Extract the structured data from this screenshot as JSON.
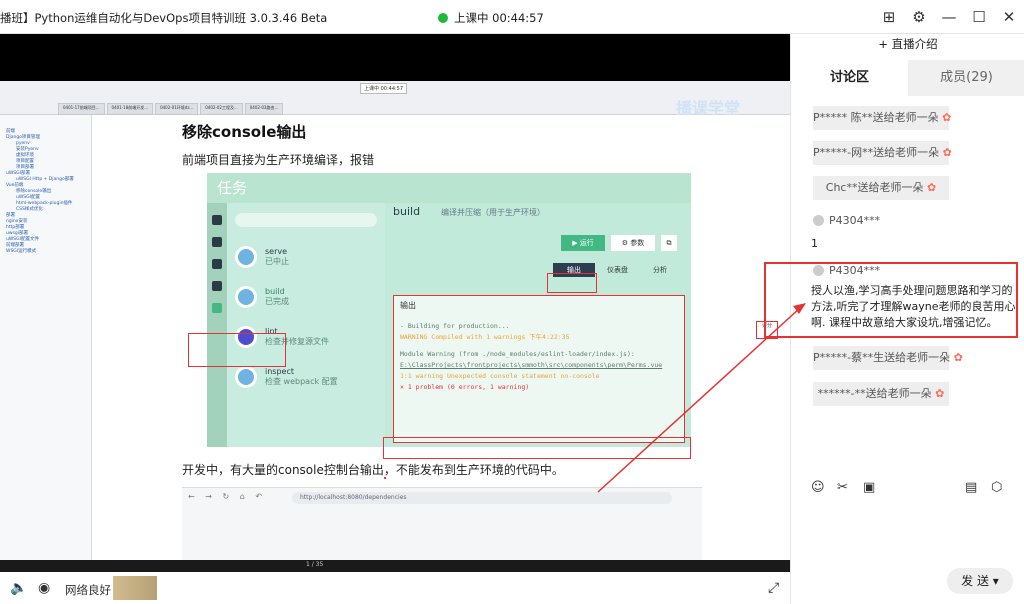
{
  "titlebar": {
    "app_title": "播班】Python运维自动化与DevOps项目特训班 3.0.3.46 Beta",
    "status": "上课中 00:44:57",
    "buttons": [
      "⊞",
      "⚙",
      "—",
      "☐",
      "✕"
    ]
  },
  "slide": {
    "mini_live": "上课中 00:44:57",
    "tabs": [
      "0401-17前端项目...",
      "0401-18前端开发...",
      "0402-01环境dz...",
      "0402-02工程及...",
      "0402-03路由..."
    ],
    "watermark": "播课学堂",
    "sidebar_lines": [
      "前端",
      "Django项目管理",
      "pyenv",
      "安装Pyenv",
      "虚拟环境",
      "项目配置",
      "项目部署",
      "uWSGI部署",
      "uWSGI Http + Django部署",
      "Vue前端",
      "移除console输出",
      "uWSGI配置",
      "html-webpack-plugin插件",
      "CSS样式优化",
      "部署",
      "nginx安装",
      "http部署",
      "uwsgi部署",
      "uWSGI配置文件",
      "前端部署",
      "WSGI运行模式"
    ],
    "doc_title": "移除console输出",
    "doc_p1": "前端项目直接为生产环境编译，报错",
    "doc_p2": "开发中，有大量的console控制台输出，不能发布到生产环境的代码中。",
    "task_title": "任务",
    "search_placeholder": "",
    "tasks": [
      {
        "name": "serve",
        "status": "已中止"
      },
      {
        "name": "build",
        "status": "已完成"
      },
      {
        "name": "lint",
        "status": "检查并修复源文件"
      },
      {
        "name": "inspect",
        "status": "检查 webpack 配置"
      }
    ],
    "build_title": "build",
    "build_subtitle": "编译并压缩（用于生产环境）",
    "run_label": "▶ 运行",
    "param_label": "⚙ 参数",
    "output_tab": "输出",
    "dashboard_tab": "仪表盘",
    "analyze_tab": "分析",
    "console_header": "输出",
    "console_lines": [
      "-  Building for production...",
      "WARNING  Compiled with 1 warnings  下午4:22:35",
      "Module Warning (from ./node_modules/eslint-loader/index.js):",
      "E:\\ClassProjects\\frontprojects\\smmoth\\src\\components\\perm\\Perms.vue",
      "  1:1  warning  Unexpected console statement  no-console",
      "✕ 1 problem (0 errors, 1 warning)"
    ],
    "browser_url": "http://localhost:8080/dependencies",
    "right_note": "评分"
  },
  "player": {
    "pager": "1 / 35"
  },
  "bottombar": {
    "network": "网络良好"
  },
  "panel": {
    "intro": "+ 直播介绍",
    "tab_discussion": "讨论区",
    "tab_members": "成员(29)",
    "gifts_top": [
      "P***** 陈**送给老师一朵",
      "P*****-网**送给老师一朵",
      "Chc**送给老师一朵"
    ],
    "msg1_user": "P4304***",
    "msg1_text": "1",
    "msg2_user": "P4304***",
    "msg2_text": [
      "授人以渔,学习高手处理问题思路和学习的",
      "方法,听完了才理解wayne老师的良苦用心",
      "啊. 课程中故意给大家设坑,增强记忆。"
    ],
    "gifts_bottom": [
      "P*****-蔡**生送给老师一朵",
      "******-**送给老师一朵"
    ],
    "send_label": "发 送"
  },
  "colors": {
    "live_green": "#1eb83b",
    "annotation_red": "#e63232",
    "vue_green": "#42b983"
  }
}
